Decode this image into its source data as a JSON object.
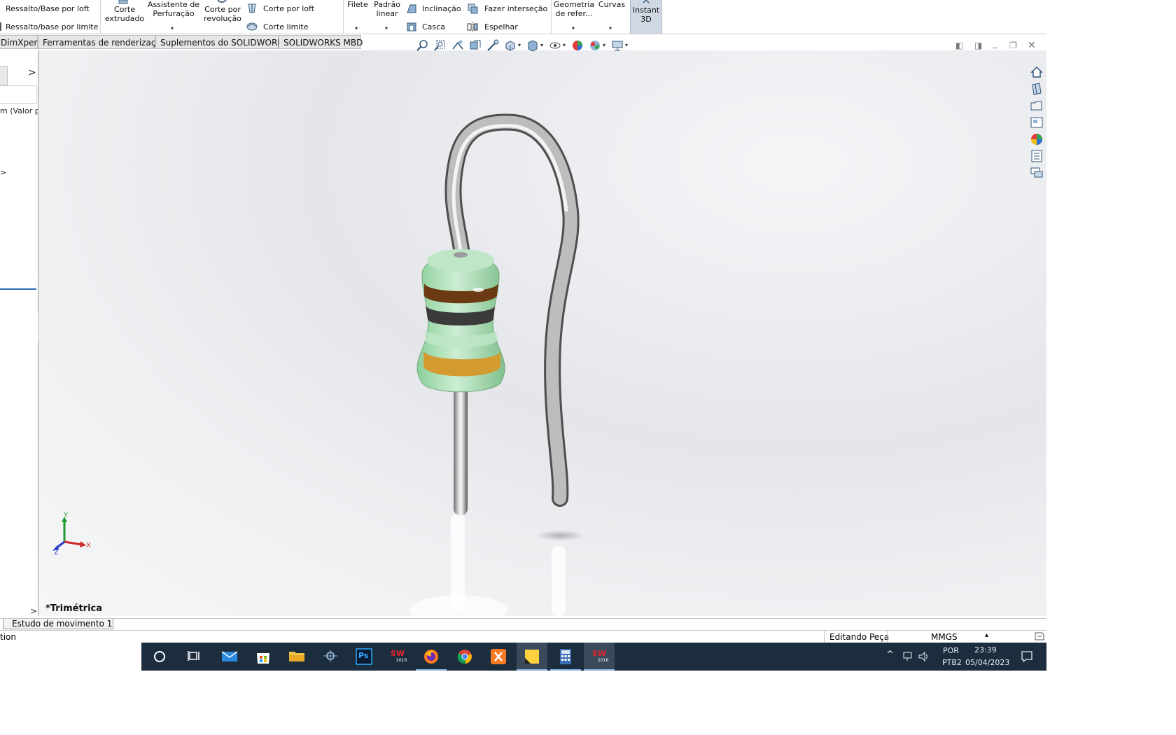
{
  "ribbon": {
    "ressalto_loft": "Ressalto/Base por loft",
    "ressalto_limite": "Ressalto/base por limite",
    "corte_extrudado_l1": "Corte",
    "corte_extrudado_l2": "extrudado",
    "assistente_l1": "Assistente de",
    "assistente_l2": "Perfuração",
    "corte_revolucao_l1": "Corte por",
    "corte_revolucao_l2": "revolução",
    "corte_loft": "Corte por loft",
    "corte_limite": "Corte limite",
    "filete": "Filete",
    "padrao_l1": "Padrão",
    "padrao_l2": "linear",
    "inclinacao": "Inclinação",
    "casca": "Casca",
    "fazer_intersecao": "Fazer interseção",
    "espelhar": "Espelhar",
    "geometria_l1": "Geometria",
    "geometria_l2": "de refer...",
    "curvas": "Curvas",
    "instant3d_l1": "Instant",
    "instant3d_l2": "3D"
  },
  "tabs": [
    "DimXpert",
    "Ferramentas de renderização",
    "Suplementos do SOLIDWORKS",
    "SOLIDWORKS MBD"
  ],
  "left_panel": {
    "chevron": ">",
    "item_text": "m  (Valor p",
    "item2": ">",
    "bottom_chevron": ">"
  },
  "viewport": {
    "view_name": "*Trimétrica",
    "triad_x": "X",
    "triad_y": "Y",
    "triad_z": "Z"
  },
  "motion": {
    "tab_label": "Estudo de movimento 1"
  },
  "status": {
    "left_text": "tion",
    "mode": "Editando Peça",
    "units": "MMGS",
    "units_caret": "▴"
  },
  "taskbar": {
    "lang_l1": "POR",
    "lang_l2": "PTB2",
    "time": "23:39",
    "date": "05/04/2023",
    "sw_label": "SW",
    "sw_year": "2016",
    "ps_label": "Ps"
  },
  "colors": {
    "taskbar_bg": "#1c2d3d",
    "instant3d_active": "#cfd8e3",
    "resistor_body": "#a8dcb3",
    "band_brown": "#6b3a12",
    "band_black": "#3a3a3a",
    "band_gold": "#d39a2f"
  }
}
